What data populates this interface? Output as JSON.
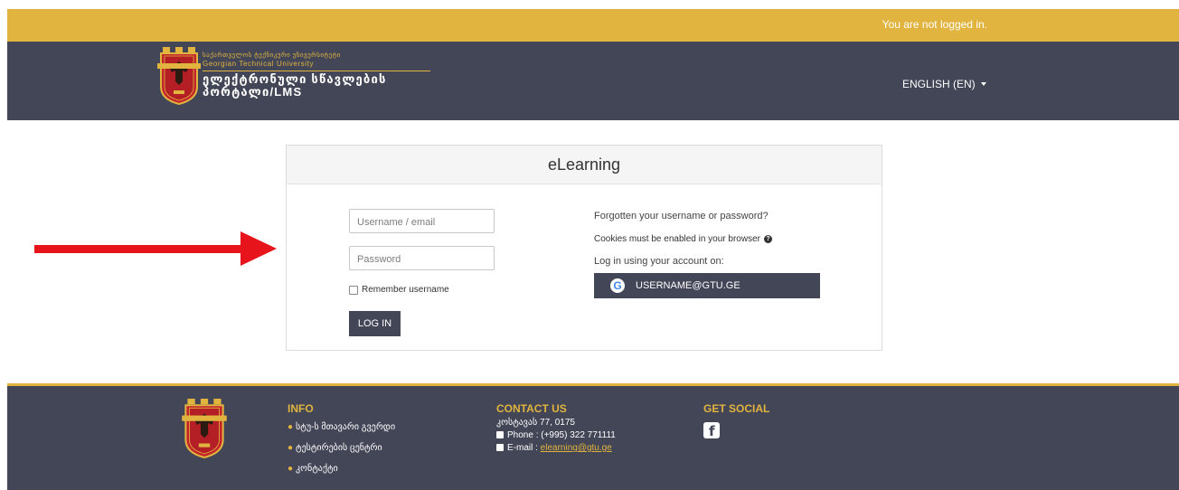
{
  "topbar": {
    "status_text": "You are not logged in."
  },
  "header": {
    "logo": {
      "line1": "საქართველოს ტექნიკური უნივერსიტეტი",
      "line2": "Georgian Technical University",
      "line3": "ელექტრონული სწავლების",
      "line4": "პორტალი/LMS"
    },
    "language": "ENGLISH (EN)"
  },
  "login": {
    "title": "eLearning",
    "username_placeholder": "Username / email",
    "password_placeholder": "Password",
    "remember_label": "Remember username",
    "login_button": "LOG IN",
    "forgot_link": "Forgotten your username or password?",
    "cookies_text": "Cookies must be enabled in your browser",
    "login_using_text": "Log in using your account on:",
    "oauth_button": "USERNAME@GTU.GE"
  },
  "footer": {
    "info": {
      "heading": "INFO",
      "items": [
        "სტუ-ს მთავარი გვერდი",
        "ტესტირების ცენტრი",
        "კონტაქტი"
      ]
    },
    "contact": {
      "heading": "CONTACT US",
      "address": "კოსტავას 77, 0175",
      "phone": "Phone : (+995) 322 771111",
      "email_label": "E-mail : ",
      "email": "elearning@gtu.ge"
    },
    "social": {
      "heading": "GET SOCIAL",
      "icon": "facebook-icon"
    }
  },
  "colors": {
    "accent": "#e1b43f",
    "header_bg": "#434657",
    "arrow": "#e8141b"
  }
}
